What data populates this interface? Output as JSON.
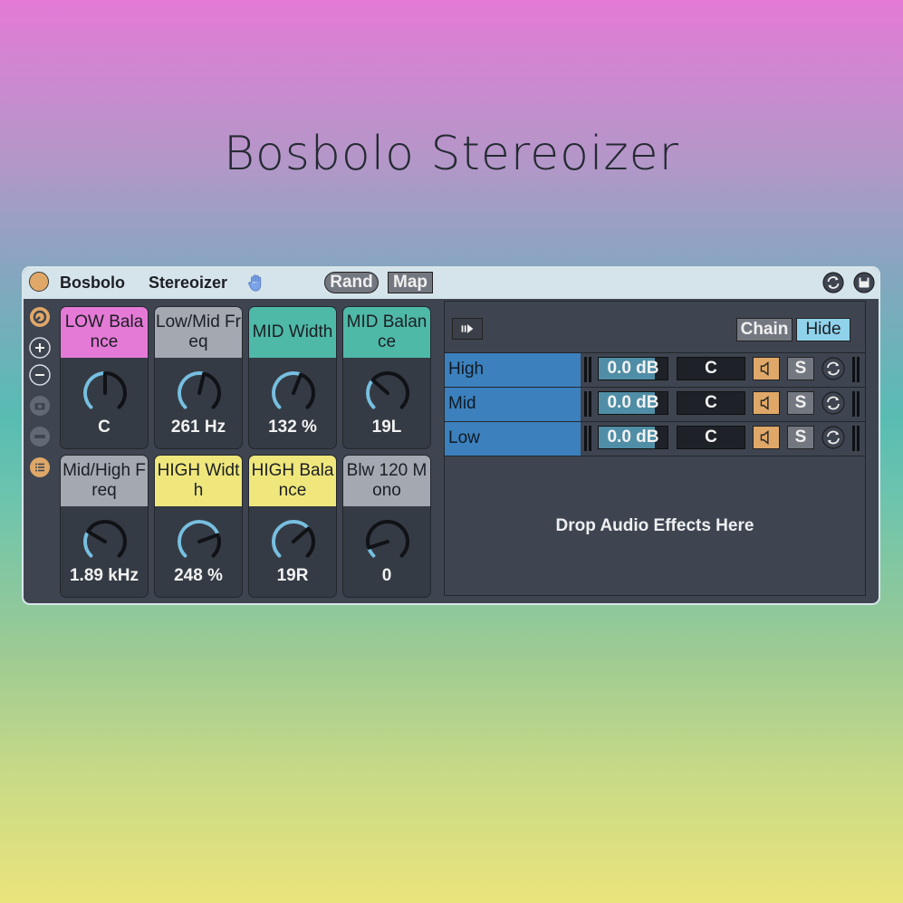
{
  "page_title": "Bosbolo Stereoizer",
  "device": {
    "name_part1": "Bosbolo",
    "name_part2": "Stereoizer",
    "rand_label": "Rand",
    "map_label": "Map"
  },
  "colors": {
    "pink": "#e47ad6",
    "grey": "#a3a8b1",
    "teal": "#4fb9a8",
    "yellow": "#efe77c",
    "accent_orange": "#e0a868",
    "chain_blue": "#3c80bd",
    "knob_arc": "#77bfe0"
  },
  "macros": [
    {
      "label": "LOW Balance",
      "value": "C",
      "color": "pink",
      "level": 0.5
    },
    {
      "label": "Low/Mid Freq",
      "value": "261 Hz",
      "color": "grey",
      "level": 0.55
    },
    {
      "label": "MID Width",
      "value": "132 %",
      "color": "teal",
      "level": 0.58
    },
    {
      "label": "MID Balance",
      "value": "19L",
      "color": "teal",
      "level": 0.32
    },
    {
      "label": "Mid/High Freq",
      "value": "1.89 kHz",
      "color": "grey",
      "level": 0.28
    },
    {
      "label": "HIGH Width",
      "value": "248 %",
      "color": "yellow",
      "level": 0.76
    },
    {
      "label": "HIGH Balance",
      "value": "19R",
      "color": "yellow",
      "level": 0.68
    },
    {
      "label": "Blw 120 Mono",
      "value": "0",
      "color": "grey",
      "level": 0.1
    }
  ],
  "chain_panel": {
    "chain_label": "Chain",
    "hide_label": "Hide",
    "chains": [
      {
        "name": "High",
        "volume": "0.0 dB",
        "pan": "C",
        "solo_label": "S"
      },
      {
        "name": "Mid",
        "volume": "0.0 dB",
        "pan": "C",
        "solo_label": "S"
      },
      {
        "name": "Low",
        "volume": "0.0 dB",
        "pan": "C",
        "solo_label": "S"
      }
    ],
    "drop_text": "Drop Audio Effects Here"
  }
}
